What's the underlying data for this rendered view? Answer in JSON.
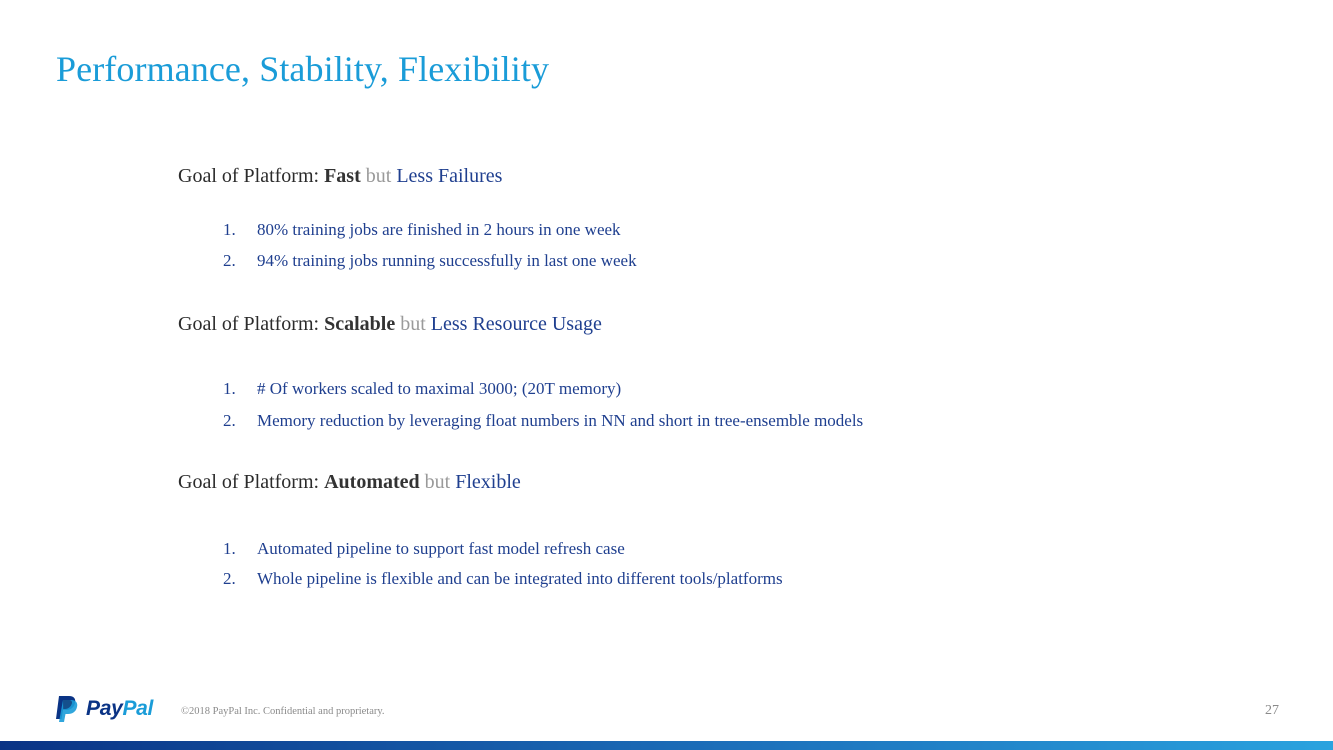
{
  "slide": {
    "title": "Performance, Stability, Flexibility",
    "sections": [
      {
        "label": "Goal of Platform:",
        "strong": "Fast",
        "connector": "but",
        "tail": "Less Failures",
        "items": [
          {
            "num": "1.",
            "text": "80% training jobs are finished in 2 hours in one week"
          },
          {
            "num": "2.",
            "text": "94% training jobs running successfully in last one week"
          }
        ]
      },
      {
        "label": "Goal of Platform:",
        "strong": "Scalable",
        "connector": "but",
        "tail": "Less Resource Usage",
        "items": [
          {
            "num": "1.",
            "text": "# Of workers scaled to maximal 3000; (20T memory)"
          },
          {
            "num": "2.",
            "text": "Memory reduction by leveraging float numbers in NN and short in tree-ensemble models"
          }
        ]
      },
      {
        "label": "Goal of Platform:",
        "strong": "Automated",
        "connector": "but",
        "tail": "Flexible",
        "items": [
          {
            "num": "1.",
            "text": "Automated pipeline to support fast model refresh case"
          },
          {
            "num": "2.",
            "text": "Whole pipeline is flexible and can be integrated into different tools/platforms"
          }
        ]
      }
    ]
  },
  "footer": {
    "logo_text_pay": "Pay",
    "logo_text_pal": "Pal",
    "copyright": "©2018 PayPal Inc. Confidential and proprietary.",
    "page_number": "27"
  },
  "colors": {
    "title": "#1a9cd8",
    "accent_text": "#1f3f8f",
    "muted": "#9a9a9a",
    "brand_dark": "#0a3385",
    "brand_light": "#1a9cd8"
  },
  "icons": {
    "logo": "paypal-logo-icon"
  }
}
